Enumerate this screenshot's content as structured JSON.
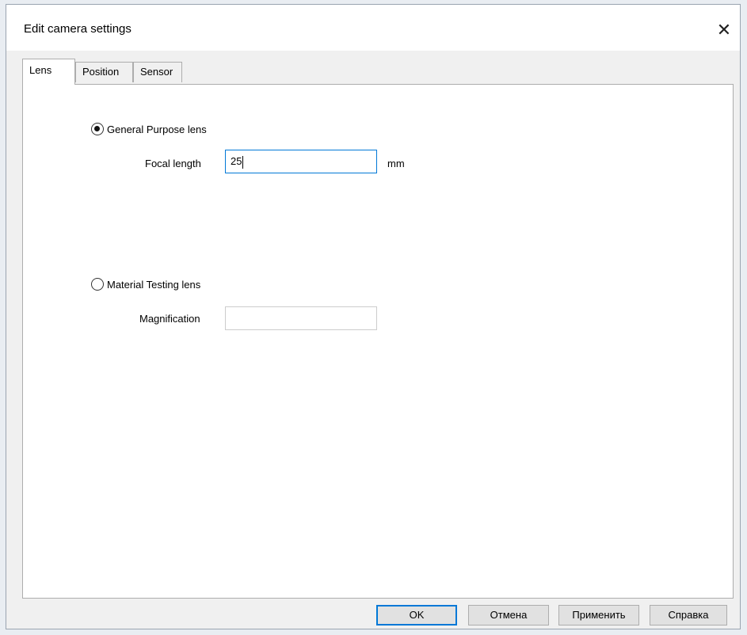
{
  "window": {
    "title": "Edit camera settings",
    "close_glyph": "✕"
  },
  "tabs": [
    {
      "label": "Lens",
      "active": true
    },
    {
      "label": "Position",
      "active": false
    },
    {
      "label": "Sensor",
      "active": false
    }
  ],
  "lens": {
    "general": {
      "label": "General Purpose lens",
      "selected": true,
      "focal_label": "Focal length",
      "focal_value": "25",
      "unit": "mm"
    },
    "material": {
      "label": "Material Testing lens",
      "selected": false,
      "magnification_label": "Magnification",
      "magnification_value": ""
    }
  },
  "buttons": {
    "ok": "OK",
    "cancel": "Отмена",
    "apply": "Применить",
    "help": "Справка"
  },
  "colors": {
    "focus_border": "#0078d7",
    "panel_bg": "#ffffff",
    "window_bg": "#f0f0f0"
  }
}
